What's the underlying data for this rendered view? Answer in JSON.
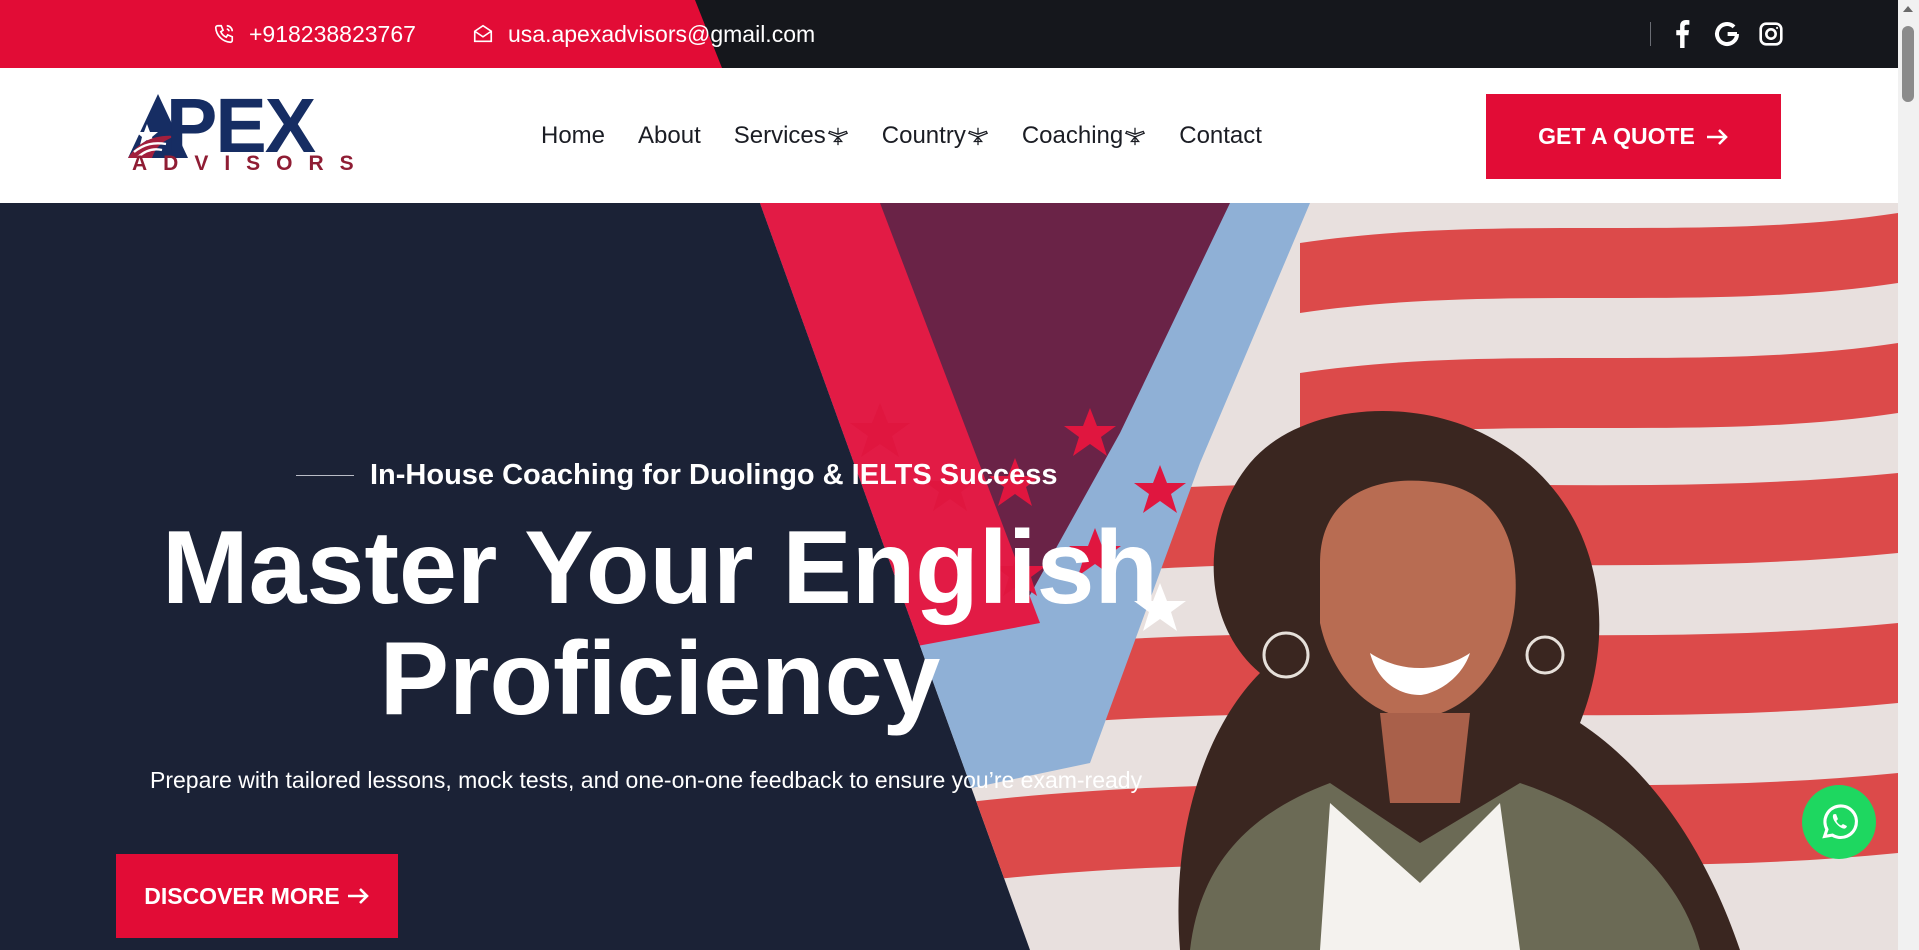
{
  "topbar": {
    "phone": "+918238823767",
    "email": "usa.apexadvisors@gmail.com",
    "social": [
      "facebook-icon",
      "google-icon",
      "instagram-icon"
    ]
  },
  "logo": {
    "word": "PEX",
    "sub": "ADVISORS"
  },
  "nav": {
    "items": [
      {
        "label": "Home",
        "dropdown": false
      },
      {
        "label": "About",
        "dropdown": false
      },
      {
        "label": "Services",
        "dropdown": true
      },
      {
        "label": "Country",
        "dropdown": true
      },
      {
        "label": "Coaching",
        "dropdown": true
      },
      {
        "label": "Contact",
        "dropdown": false
      }
    ]
  },
  "header": {
    "cta_label": "GET A QUOTE"
  },
  "hero": {
    "tagline": "In-House Coaching for Duolingo & IELTS Success",
    "title_line1": "Master Your English",
    "title_line2": "Proficiency",
    "description": "Prepare with tailored lessons, mock tests, and one-on-one feedback to ensure you’re exam-ready",
    "cta_label": "DISCOVER MORE"
  },
  "colors": {
    "brand_red": "#e20c36",
    "navy": "#1b2236",
    "whatsapp": "#1ed760"
  }
}
